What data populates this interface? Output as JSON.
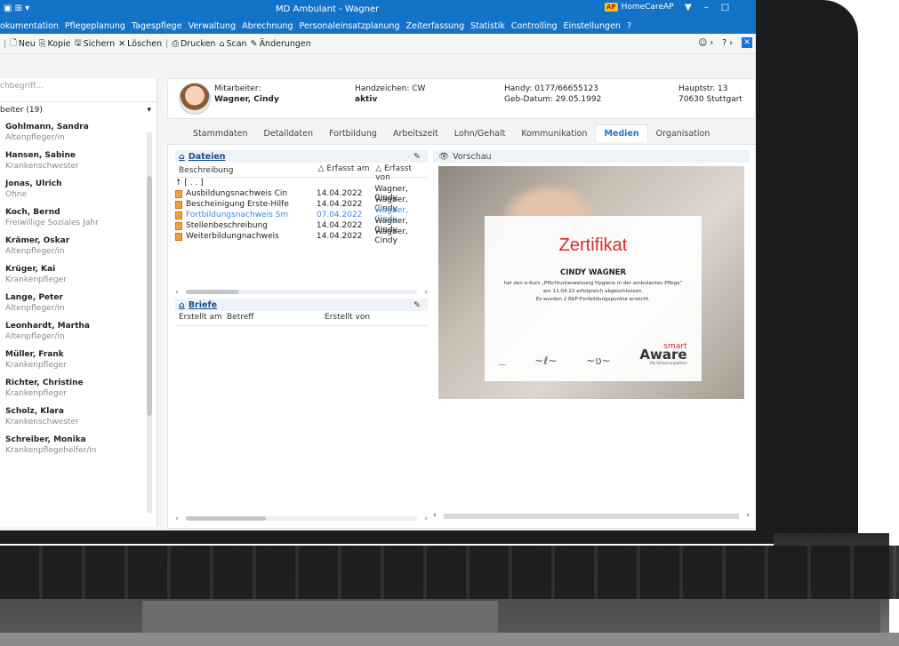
{
  "window": {
    "title": "MD Ambulant - Wagner",
    "brand_badge": "AP",
    "brand_name": "HomeCareAP"
  },
  "menu": [
    "okumentation",
    "Pflegeplanung",
    "Tagespflege",
    "Verwaltung",
    "Abrechnung",
    "Personaleinsatzplanung",
    "Zeiterfassung",
    "Statistik",
    "Controlling",
    "Einstellungen",
    "?"
  ],
  "toolbar": {
    "neu": "Neu",
    "kopie": "Kopie",
    "sichern": "Sichern",
    "loeschen": "Löschen",
    "drucken": "Drucken",
    "scan": "Scan",
    "aenderungen": "Änderungen"
  },
  "sidebar": {
    "search_placeholder": "chbegriff...",
    "group_label": "beiter (19)",
    "staff": [
      {
        "name": "Gohlmann, Sandra",
        "role": "Altenpfleger/in"
      },
      {
        "name": "Hansen, Sabine",
        "role": "Krankenschwester"
      },
      {
        "name": "Jonas, Ulrich",
        "role": "Ohne"
      },
      {
        "name": "Koch, Bernd",
        "role": "Freiwillige Soziales Jahr"
      },
      {
        "name": "Krämer, Oskar",
        "role": "Altenpfleger/in"
      },
      {
        "name": "Krüger, Kai",
        "role": "Krankenpfleger"
      },
      {
        "name": "Lange, Peter",
        "role": "Altenpfleger/in"
      },
      {
        "name": "Leonhardt, Martha",
        "role": "Altenpfleger/in"
      },
      {
        "name": "Müller, Frank",
        "role": "Krankenpfleger"
      },
      {
        "name": "Richter, Christine",
        "role": "Krankenpfleger"
      },
      {
        "name": "Scholz, Klara",
        "role": "Krankenschwester"
      },
      {
        "name": "Schreiber, Monika",
        "role": "Krankenpflegehelfer/in"
      }
    ]
  },
  "header": {
    "mitarbeiter_label": "Mitarbeiter:",
    "mitarbeiter_value": "Wagner, Cindy",
    "handzeichen_label": "Handzeichen: CW",
    "status_value": "aktiv",
    "handy_label": "Handy: 0177/66655123",
    "geb_label": "Geb-Datum: 29.05.1992",
    "street": "Hauptstr. 13",
    "city": "70630 Stuttgart"
  },
  "tabs": [
    "Stammdaten",
    "Detaildaten",
    "Fortbildung",
    "Arbeitszeit",
    "Lohn/Gehalt",
    "Kommunikation",
    "Medien",
    "Organisation"
  ],
  "active_tab": "Medien",
  "dateien": {
    "title": "Dateien",
    "columns": [
      "Beschreibung",
      "△ Erfasst am",
      "△ Erfasst von"
    ],
    "parent_row": "[ . . ]",
    "rows": [
      {
        "desc": "Ausbildungsnachweis Cin",
        "date": "14.04.2022",
        "by": "Wagner, Cindy"
      },
      {
        "desc": "Bescheinigung Erste-Hilfe",
        "date": "14.04.2022",
        "by": "Wagner, Cindy"
      },
      {
        "desc": "Fortbildungsnachweis Sm",
        "date": "07.04.2022",
        "by": "Wagner, Cindy"
      },
      {
        "desc": "Stellenbeschreibung",
        "date": "14.04.2022",
        "by": "Wagner, Cindy"
      },
      {
        "desc": "Weiterbildungnachweis",
        "date": "14.04.2022",
        "by": "Wagner, Cindy"
      }
    ]
  },
  "briefe": {
    "title": "Briefe",
    "columns": [
      "Erstellt am",
      "Betreff",
      "Erstellt von"
    ]
  },
  "preview": {
    "title": "Vorschau",
    "cert_title": "Zertifikat",
    "cert_name": "CINDY WAGNER",
    "cert_line1": "hat den e-Kurs „Pflichtunterweisung Hygiene in der ambulanten Pflege“",
    "cert_line2": "am 11.04.22 erfolgreich abgeschlossen.",
    "cert_line3": "Es wurden 2 RbP-Fortbildungspunkte erreicht.",
    "logo_brand_top": "smart",
    "logo_brand_main": "Aware",
    "logo_brand_sub": "My School anywhere"
  }
}
